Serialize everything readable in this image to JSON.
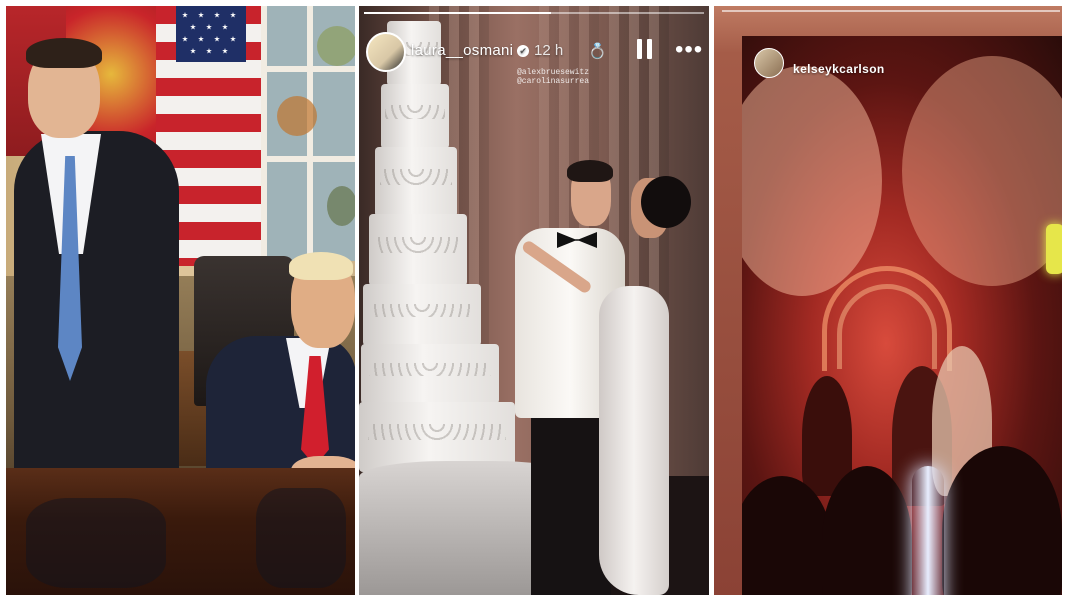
{
  "panel_story": {
    "username": "laura__osmani",
    "verified_mark": "✔",
    "time": "12 h",
    "mentions": [
      "@alexbruesewitz",
      "@carolinasurrea"
    ],
    "icons": [
      "ring-icon",
      "pause-icon",
      "more-icon"
    ]
  },
  "panel_reception": {
    "username": "kelseykcarlson"
  },
  "colors": {
    "story_text": "#ffffff",
    "reception_glow": "#d84b3c"
  }
}
